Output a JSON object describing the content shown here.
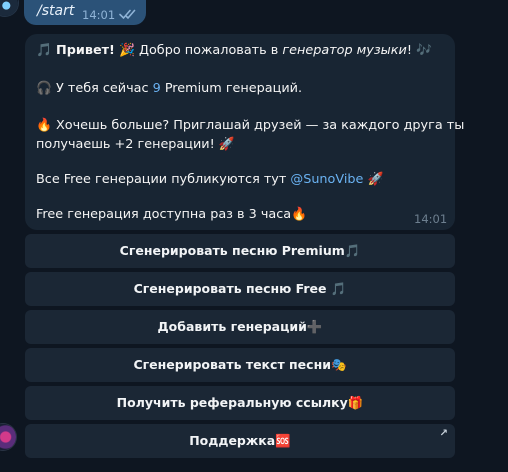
{
  "outgoing": {
    "text": "/start",
    "time": "14:01"
  },
  "incoming": {
    "line1_emoji_note": "🎵",
    "line1_bold": "Привет!",
    "line1_party": "🎉",
    "line1_text": " Добро пожаловать в ",
    "line1_italic": "генератор музыки",
    "line1_end": "! 🎶",
    "line2_emoji": "🎧",
    "line2_pre": " У тебя сейчас ",
    "line2_num": "9",
    "line2_post": " Premium генераций.",
    "line3_emoji": "🔥",
    "line3_text": " Хочешь больше? Приглашай друзей — за каждого друга ты",
    "line4_text": "получаешь +2 генерации! 🚀",
    "line5_pre": "Все Free генерации публикуются тут ",
    "line5_link": "@SunoVibe",
    "line5_end": " 🚀",
    "line6_text": "Free генерация доступна раз в 3 часа🔥",
    "time": "14:01"
  },
  "keyboard": {
    "btn1": "Сгенерировать песню Premium🎵",
    "btn2": "Сгенерировать песню Free 🎵",
    "btn3": "Добавить генераций➕",
    "btn4": "Сгенерировать текст песни🎭",
    "btn5": "Получить реферальную ссылку🎁",
    "btn6": "Поддержка🆘",
    "btn6_corner": "↗"
  }
}
